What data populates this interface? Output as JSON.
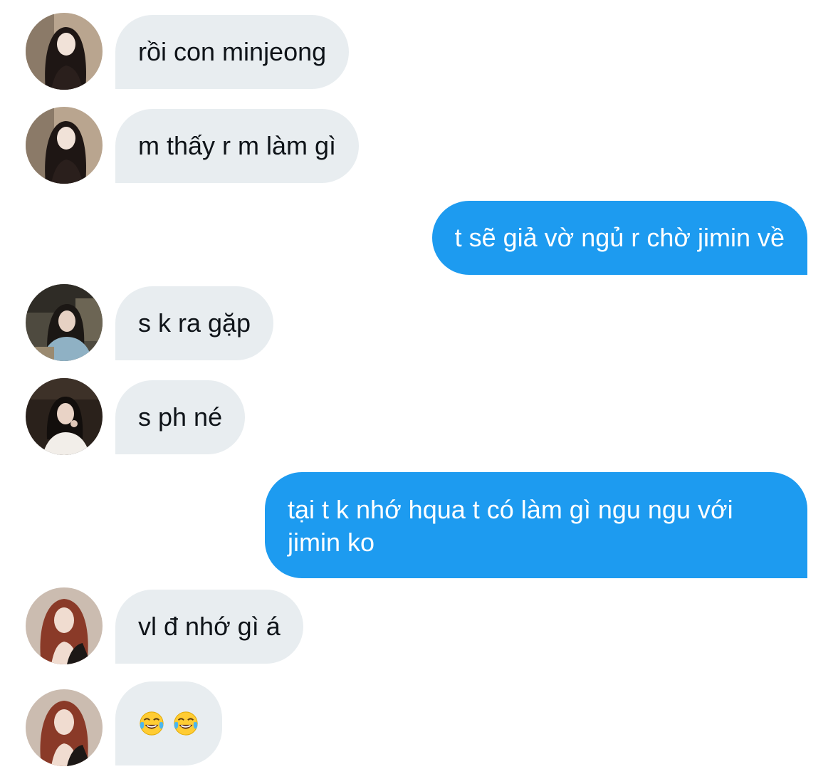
{
  "messages": [
    {
      "side": "in",
      "text": "rồi con minjeong",
      "avatar": "avatar-dark-hair"
    },
    {
      "side": "in",
      "text": "m thấy r m làm gì",
      "avatar": "avatar-dark-hair"
    },
    {
      "side": "out",
      "text": "t sẽ giả vờ ngủ r chờ jimin về"
    },
    {
      "side": "in",
      "text": "s k ra gặp",
      "avatar": "avatar-cafe"
    },
    {
      "side": "in",
      "text": "s ph né",
      "avatar": "avatar-night"
    },
    {
      "side": "out",
      "text": "tại t k nhớ hqua t có làm gì ngu ngu với jimin ko"
    },
    {
      "side": "in",
      "text": "vl đ nhớ gì á",
      "avatar": "avatar-red-hair"
    },
    {
      "side": "in",
      "emoji": [
        "face-with-tears-of-joy-icon",
        "face-with-tears-of-joy-icon"
      ],
      "avatar": "avatar-red-hair"
    }
  ],
  "colors": {
    "incoming_bubble": "#e8edf0",
    "outgoing_bubble": "#1d9bf0",
    "incoming_text": "#0f1419",
    "outgoing_text": "#ffffff"
  }
}
